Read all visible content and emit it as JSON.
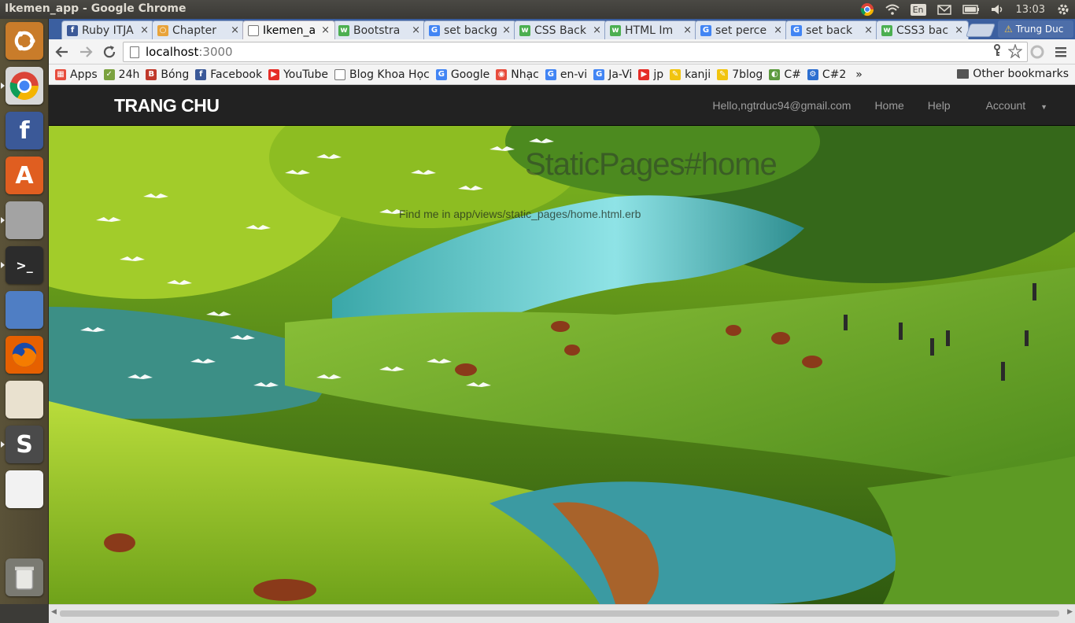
{
  "os": {
    "window_title": "Ikemen_app - Google Chrome",
    "keyboard_layout": "En",
    "clock": "13:03",
    "indicators": [
      "chrome-icon",
      "wifi-icon",
      "keyboard-icon",
      "mail-icon",
      "battery-icon",
      "volume-icon",
      "gear-icon"
    ]
  },
  "launcher": {
    "items": [
      {
        "name": "ubuntu-dash-icon",
        "color": "#c97c2a"
      },
      {
        "name": "chrome-icon",
        "color": "#d8d8d8"
      },
      {
        "name": "facebook-icon",
        "color": "#3b5998",
        "glyph": "f"
      },
      {
        "name": "software-center-icon",
        "color": "#e05e20",
        "glyph": "A"
      },
      {
        "name": "files-icon",
        "color": "#a3a3a3"
      },
      {
        "name": "terminal-icon",
        "color": "#2c2c2c",
        "glyph": ">_"
      },
      {
        "name": "document-viewer-icon",
        "color": "#4f7ec4"
      },
      {
        "name": "firefox-icon",
        "color": "#e66000"
      },
      {
        "name": "ebook-reader-icon",
        "color": "#e9e1cf"
      },
      {
        "name": "sublime-text-icon",
        "color": "#4a4a4a",
        "glyph": "S"
      },
      {
        "name": "editor-icon",
        "color": "#f2f2f2"
      },
      {
        "name": "trash-icon",
        "color": "#7a7a72"
      }
    ]
  },
  "tabs": [
    {
      "label": "Ruby ITJA",
      "icon": "facebook-icon",
      "color": "#3b5998",
      "glyph": "f",
      "active": false
    },
    {
      "label": "Chapter",
      "icon": "loading-icon",
      "color": "#e8a33a",
      "glyph": "○",
      "active": false
    },
    {
      "label": "Ikemen_a",
      "icon": "page-icon",
      "color": "#ffffff",
      "glyph": "",
      "active": true
    },
    {
      "label": "Bootstra",
      "icon": "w3schools-icon",
      "color": "#4caf50",
      "glyph": "w",
      "active": false
    },
    {
      "label": "set backg",
      "icon": "google-icon",
      "color": "#4285f4",
      "glyph": "G",
      "active": false
    },
    {
      "label": "CSS Back",
      "icon": "w3schools-icon",
      "color": "#4caf50",
      "glyph": "w",
      "active": false
    },
    {
      "label": "HTML Im",
      "icon": "w3schools-icon",
      "color": "#4caf50",
      "glyph": "w",
      "active": false
    },
    {
      "label": "set perce",
      "icon": "google-icon",
      "color": "#4285f4",
      "glyph": "G",
      "active": false
    },
    {
      "label": "set back",
      "icon": "google-icon",
      "color": "#4285f4",
      "glyph": "G",
      "active": false
    },
    {
      "label": "CSS3 bac",
      "icon": "w3schools-icon",
      "color": "#4caf50",
      "glyph": "w",
      "active": false
    }
  ],
  "profile": {
    "warning_icon": "warning-icon",
    "name": "Trung Duc"
  },
  "toolbar": {
    "url_host": "localhost",
    "url_port": ":3000"
  },
  "bookmarks": [
    {
      "label": "Apps",
      "icon": "apps-icon",
      "color": "#e74c3c",
      "glyph": "▦"
    },
    {
      "label": "24h",
      "icon": "24h-icon",
      "color": "#7ba23f",
      "glyph": "✓"
    },
    {
      "label": "Bóng",
      "icon": "bong-icon",
      "color": "#c0392b",
      "glyph": "B"
    },
    {
      "label": "Facebook",
      "icon": "facebook-icon",
      "color": "#3b5998",
      "glyph": "f"
    },
    {
      "label": "YouTube",
      "icon": "youtube-icon",
      "color": "#e52d27",
      "glyph": "▶"
    },
    {
      "label": "Blog Khoa Học",
      "icon": "page-icon",
      "color": "#ffffff",
      "glyph": ""
    },
    {
      "label": "Google",
      "icon": "google-icon",
      "color": "#4285f4",
      "glyph": "G"
    },
    {
      "label": "Nhạc",
      "icon": "music-icon",
      "color": "#e74c3c",
      "glyph": "◉"
    },
    {
      "label": "en-vi",
      "icon": "translate-icon",
      "color": "#4285f4",
      "glyph": "G"
    },
    {
      "label": "Ja-Vi",
      "icon": "translate-icon",
      "color": "#4285f4",
      "glyph": "G"
    },
    {
      "label": "jp",
      "icon": "youtube-icon",
      "color": "#e52d27",
      "glyph": "▶"
    },
    {
      "label": "kanji",
      "icon": "kanji-icon",
      "color": "#f1c40f",
      "glyph": "✎"
    },
    {
      "label": "7blog",
      "icon": "7blog-icon",
      "color": "#f1c40f",
      "glyph": "✎"
    },
    {
      "label": "C#",
      "icon": "csharp-icon",
      "color": "#5c9a3e",
      "glyph": "◐"
    },
    {
      "label": "C#2",
      "icon": "csharp2-icon",
      "color": "#2d6fd0",
      "glyph": "⚙"
    }
  ],
  "bookmarks_more": "»",
  "other_bookmarks": "Other bookmarks",
  "site": {
    "brand": "TRANG CHU",
    "nav": [
      "Hello,ngtrduc94@gmail.com",
      "Home",
      "Help",
      "Account"
    ],
    "hero_title": "StaticPages#home",
    "hero_subtitle": "Find me in app/views/static_pages/home.html.erb"
  }
}
